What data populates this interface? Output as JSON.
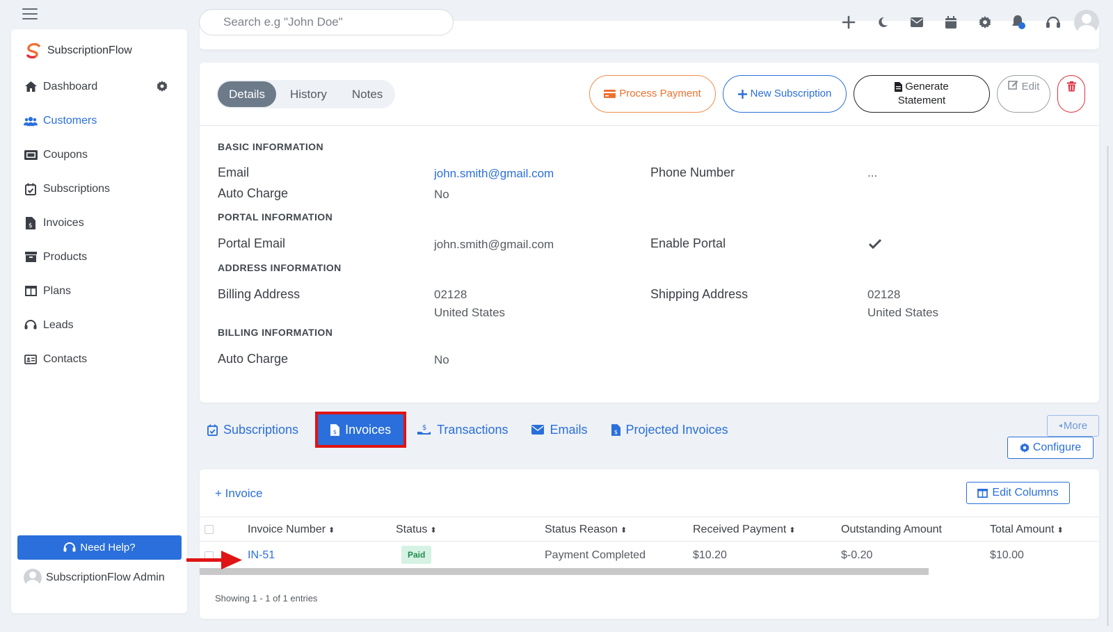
{
  "topbar": {
    "search_placeholder": "Search e.g \"John Doe\"",
    "icons": [
      "plus-icon",
      "moon-icon",
      "envelope-icon",
      "calendar-icon",
      "gear-icon",
      "bell-icon",
      "headset-icon",
      "avatar"
    ]
  },
  "sidebar": {
    "brand": "SubscriptionFlow",
    "items": [
      {
        "label": "Dashboard",
        "icon": "home-icon"
      },
      {
        "label": "Customers",
        "icon": "users-icon",
        "active": true
      },
      {
        "label": "Coupons",
        "icon": "ticket-icon"
      },
      {
        "label": "Subscriptions",
        "icon": "calendar-check-icon"
      },
      {
        "label": "Invoices",
        "icon": "invoice-icon"
      },
      {
        "label": "Products",
        "icon": "archive-icon"
      },
      {
        "label": "Plans",
        "icon": "columns-icon"
      },
      {
        "label": "Leads",
        "icon": "headset-icon"
      },
      {
        "label": "Contacts",
        "icon": "id-card-icon"
      }
    ],
    "help_label": "Need Help?",
    "admin_name": "SubscriptionFlow Admin"
  },
  "details": {
    "tabs": [
      "Details",
      "History",
      "Notes"
    ],
    "actions": {
      "process_payment": "Process Payment",
      "new_subscription": "New Subscription",
      "generate": "Generate",
      "statement": "Statement",
      "edit": "Edit"
    },
    "sections": {
      "basic": "BASIC INFORMATION",
      "portal": "PORTAL INFORMATION",
      "address": "ADDRESS INFORMATION",
      "billing": "BILLING INFORMATION"
    },
    "fields": {
      "email_label": "Email",
      "email_value": "john.smith@gmail.com",
      "phone_label": "Phone Number",
      "phone_value": "...",
      "auto_charge_label": "Auto Charge",
      "auto_charge_value": "No",
      "portal_email_label": "Portal Email",
      "portal_email_value": "john.smith@gmail.com",
      "enable_portal_label": "Enable Portal",
      "billing_address_label": "Billing Address",
      "billing_zip": "02128",
      "billing_country": "United States",
      "shipping_address_label": "Shipping Address",
      "shipping_zip": "02128",
      "shipping_country": "United States",
      "billing_auto_charge_label": "Auto Charge",
      "billing_auto_charge_value": "No"
    }
  },
  "related_tabs": {
    "items": [
      "Subscriptions",
      "Invoices",
      "Transactions",
      "Emails",
      "Projected Invoices"
    ],
    "more_label": "More",
    "configure_label": "Configure"
  },
  "invoices": {
    "add_label": "+ Invoice",
    "edit_columns_label": "Edit Columns",
    "columns": [
      "Invoice Number",
      "Status",
      "Status Reason",
      "Received Payment",
      "Outstanding Amount",
      "Total Amount"
    ],
    "rows": [
      {
        "invoice_number": "IN-51",
        "status": "Paid",
        "status_reason": "Payment Completed",
        "received_payment": "$10.20",
        "outstanding_amount": "$-0.20",
        "total_amount": "$10.00"
      }
    ],
    "showing": "Showing 1 - 1 of 1 entries"
  },
  "colors": {
    "accent": "#2a6fdb",
    "orange": "#ee7130",
    "danger": "#e12d3e",
    "highlight": "#e01414"
  }
}
